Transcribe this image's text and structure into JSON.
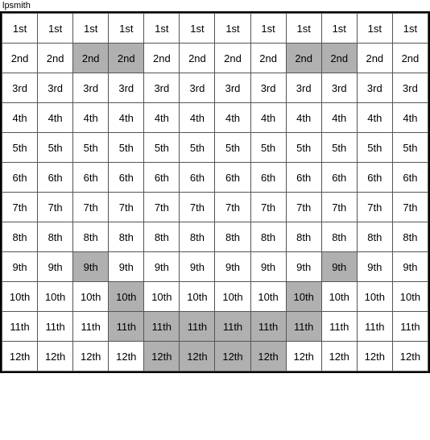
{
  "title": "lpsmith",
  "rows": [
    {
      "label": "1st",
      "cells": [
        {
          "text": "1st",
          "h": false
        },
        {
          "text": "1st",
          "h": false
        },
        {
          "text": "1st",
          "h": false
        },
        {
          "text": "1st",
          "h": false
        },
        {
          "text": "1st",
          "h": false
        },
        {
          "text": "1st",
          "h": false
        },
        {
          "text": "1st",
          "h": false
        },
        {
          "text": "1st",
          "h": false
        },
        {
          "text": "1st",
          "h": false
        },
        {
          "text": "1st",
          "h": false
        },
        {
          "text": "1st",
          "h": false
        },
        {
          "text": "1st",
          "h": false
        }
      ]
    },
    {
      "label": "2nd",
      "cells": [
        {
          "text": "2nd",
          "h": false
        },
        {
          "text": "2nd",
          "h": false
        },
        {
          "text": "2nd",
          "h": true
        },
        {
          "text": "2nd",
          "h": true
        },
        {
          "text": "2nd",
          "h": false
        },
        {
          "text": "2nd",
          "h": false
        },
        {
          "text": "2nd",
          "h": false
        },
        {
          "text": "2nd",
          "h": false
        },
        {
          "text": "2nd",
          "h": true
        },
        {
          "text": "2nd",
          "h": true
        },
        {
          "text": "2nd",
          "h": false
        },
        {
          "text": "2nd",
          "h": false
        }
      ]
    },
    {
      "label": "3rd",
      "cells": [
        {
          "text": "3rd",
          "h": false
        },
        {
          "text": "3rd",
          "h": false
        },
        {
          "text": "3rd",
          "h": false
        },
        {
          "text": "3rd",
          "h": false
        },
        {
          "text": "3rd",
          "h": false
        },
        {
          "text": "3rd",
          "h": false
        },
        {
          "text": "3rd",
          "h": false
        },
        {
          "text": "3rd",
          "h": false
        },
        {
          "text": "3rd",
          "h": false
        },
        {
          "text": "3rd",
          "h": false
        },
        {
          "text": "3rd",
          "h": false
        },
        {
          "text": "3rd",
          "h": false
        }
      ]
    },
    {
      "label": "4th",
      "cells": [
        {
          "text": "4th",
          "h": false
        },
        {
          "text": "4th",
          "h": false
        },
        {
          "text": "4th",
          "h": false
        },
        {
          "text": "4th",
          "h": false
        },
        {
          "text": "4th",
          "h": false
        },
        {
          "text": "4th",
          "h": false
        },
        {
          "text": "4th",
          "h": false
        },
        {
          "text": "4th",
          "h": false
        },
        {
          "text": "4th",
          "h": false
        },
        {
          "text": "4th",
          "h": false
        },
        {
          "text": "4th",
          "h": false
        },
        {
          "text": "4th",
          "h": false
        }
      ]
    },
    {
      "label": "5th",
      "cells": [
        {
          "text": "5th",
          "h": false
        },
        {
          "text": "5th",
          "h": false
        },
        {
          "text": "5th",
          "h": false
        },
        {
          "text": "5th",
          "h": false
        },
        {
          "text": "5th",
          "h": false
        },
        {
          "text": "5th",
          "h": false
        },
        {
          "text": "5th",
          "h": false
        },
        {
          "text": "5th",
          "h": false
        },
        {
          "text": "5th",
          "h": false
        },
        {
          "text": "5th",
          "h": false
        },
        {
          "text": "5th",
          "h": false
        },
        {
          "text": "5th",
          "h": false
        }
      ]
    },
    {
      "label": "6th",
      "cells": [
        {
          "text": "6th",
          "h": false
        },
        {
          "text": "6th",
          "h": false
        },
        {
          "text": "6th",
          "h": false
        },
        {
          "text": "6th",
          "h": false
        },
        {
          "text": "6th",
          "h": false
        },
        {
          "text": "6th",
          "h": false
        },
        {
          "text": "6th",
          "h": false
        },
        {
          "text": "6th",
          "h": false
        },
        {
          "text": "6th",
          "h": false
        },
        {
          "text": "6th",
          "h": false
        },
        {
          "text": "6th",
          "h": false
        },
        {
          "text": "6th",
          "h": false
        }
      ]
    },
    {
      "label": "7th",
      "cells": [
        {
          "text": "7th",
          "h": false
        },
        {
          "text": "7th",
          "h": false
        },
        {
          "text": "7th",
          "h": false
        },
        {
          "text": "7th",
          "h": false
        },
        {
          "text": "7th",
          "h": false
        },
        {
          "text": "7th",
          "h": false
        },
        {
          "text": "7th",
          "h": false
        },
        {
          "text": "7th",
          "h": false
        },
        {
          "text": "7th",
          "h": false
        },
        {
          "text": "7th",
          "h": false
        },
        {
          "text": "7th",
          "h": false
        },
        {
          "text": "7th",
          "h": false
        }
      ]
    },
    {
      "label": "8th",
      "cells": [
        {
          "text": "8th",
          "h": false
        },
        {
          "text": "8th",
          "h": false
        },
        {
          "text": "8th",
          "h": false
        },
        {
          "text": "8th",
          "h": false
        },
        {
          "text": "8th",
          "h": false
        },
        {
          "text": "8th",
          "h": false
        },
        {
          "text": "8th",
          "h": false
        },
        {
          "text": "8th",
          "h": false
        },
        {
          "text": "8th",
          "h": false
        },
        {
          "text": "8th",
          "h": false
        },
        {
          "text": "8th",
          "h": false
        },
        {
          "text": "8th",
          "h": false
        }
      ]
    },
    {
      "label": "9th",
      "cells": [
        {
          "text": "9th",
          "h": false
        },
        {
          "text": "9th",
          "h": false
        },
        {
          "text": "9th",
          "h": true
        },
        {
          "text": "9th",
          "h": false
        },
        {
          "text": "9th",
          "h": false
        },
        {
          "text": "9th",
          "h": false
        },
        {
          "text": "9th",
          "h": false
        },
        {
          "text": "9th",
          "h": false
        },
        {
          "text": "9th",
          "h": false
        },
        {
          "text": "9th",
          "h": true
        },
        {
          "text": "9th",
          "h": false
        },
        {
          "text": "9th",
          "h": false
        }
      ]
    },
    {
      "label": "10th",
      "cells": [
        {
          "text": "10th",
          "h": false
        },
        {
          "text": "10th",
          "h": false
        },
        {
          "text": "10th",
          "h": false
        },
        {
          "text": "10th",
          "h": true
        },
        {
          "text": "10th",
          "h": false
        },
        {
          "text": "10th",
          "h": false
        },
        {
          "text": "10th",
          "h": false
        },
        {
          "text": "10th",
          "h": false
        },
        {
          "text": "10th",
          "h": true
        },
        {
          "text": "10th",
          "h": false
        },
        {
          "text": "10th",
          "h": false
        },
        {
          "text": "10th",
          "h": false
        }
      ]
    },
    {
      "label": "11th",
      "cells": [
        {
          "text": "11th",
          "h": false
        },
        {
          "text": "11th",
          "h": false
        },
        {
          "text": "11th",
          "h": false
        },
        {
          "text": "11th",
          "h": true
        },
        {
          "text": "11th",
          "h": true
        },
        {
          "text": "11th",
          "h": true
        },
        {
          "text": "11th",
          "h": true
        },
        {
          "text": "11th",
          "h": true
        },
        {
          "text": "11th",
          "h": true
        },
        {
          "text": "11th",
          "h": false
        },
        {
          "text": "11th",
          "h": false
        },
        {
          "text": "11th",
          "h": false
        }
      ]
    },
    {
      "label": "12th",
      "cells": [
        {
          "text": "12th",
          "h": false
        },
        {
          "text": "12th",
          "h": false
        },
        {
          "text": "12th",
          "h": false
        },
        {
          "text": "12th",
          "h": false
        },
        {
          "text": "12th",
          "h": true
        },
        {
          "text": "12th",
          "h": true
        },
        {
          "text": "12th",
          "h": true
        },
        {
          "text": "12th",
          "h": true
        },
        {
          "text": "12th",
          "h": false
        },
        {
          "text": "12th",
          "h": false
        },
        {
          "text": "12th",
          "h": false
        },
        {
          "text": "12th",
          "h": false
        }
      ]
    }
  ]
}
